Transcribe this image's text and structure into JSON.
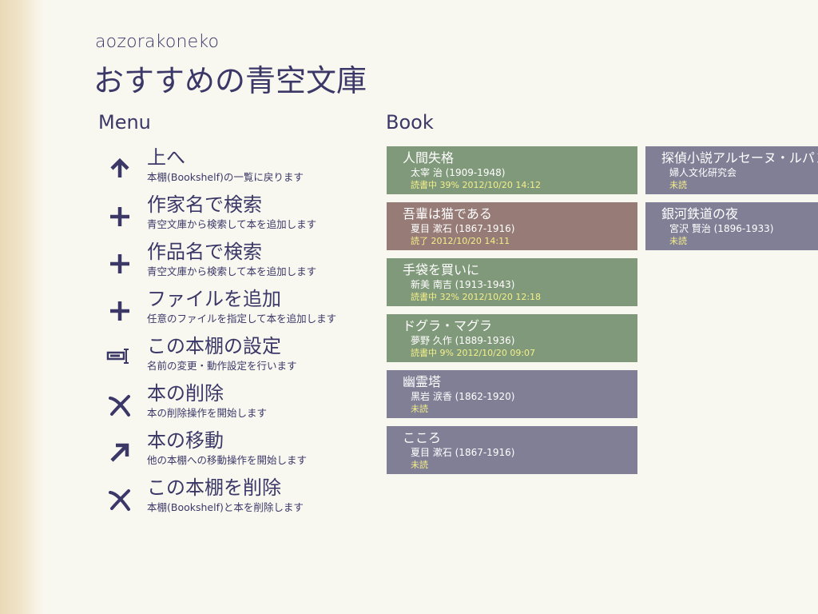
{
  "app": {
    "name": "aozorakoneko",
    "title": "おすすめの青空文庫"
  },
  "menu": {
    "heading": "Menu",
    "items": [
      {
        "icon": "arrow-up-icon",
        "label": "上へ",
        "description": "本棚(Bookshelf)の一覧に戻ります"
      },
      {
        "icon": "plus-icon",
        "label": "作家名で検索",
        "description": "青空文庫から検索して本を追加します"
      },
      {
        "icon": "plus-icon",
        "label": "作品名で検索",
        "description": "青空文庫から検索して本を追加します"
      },
      {
        "icon": "plus-icon",
        "label": "ファイルを追加",
        "description": "任意のファイルを指定して本を追加します"
      },
      {
        "icon": "rename-icon",
        "label": "この本棚の設定",
        "description": "名前の変更・動作設定を行います"
      },
      {
        "icon": "delete-icon",
        "label": "本の削除",
        "description": "本の削除操作を開始します"
      },
      {
        "icon": "move-arrow-icon",
        "label": "本の移動",
        "description": "他の本棚への移動操作を開始します"
      },
      {
        "icon": "delete-icon",
        "label": "この本棚を削除",
        "description": "本棚(Bookshelf)と本を削除します"
      }
    ]
  },
  "books": {
    "heading": "Book",
    "items": [
      {
        "title": "人間失格",
        "author": "太宰 治 (1909-1948)",
        "status": "読書中 39% 2012/10/20 14:12",
        "color": "#80997a"
      },
      {
        "title": "吾輩は猫である",
        "author": "夏目 漱石 (1867-1916)",
        "status": "読了 2012/10/20 14:11",
        "color": "#967b76"
      },
      {
        "title": "手袋を買いに",
        "author": "新美 南吉 (1913-1943)",
        "status": "読書中 32% 2012/10/20 12:18",
        "color": "#80997a"
      },
      {
        "title": "ドグラ・マグラ",
        "author": "夢野 久作 (1889-1936)",
        "status": "読書中 9% 2012/10/20 09:07",
        "color": "#80997a"
      },
      {
        "title": "幽霊塔",
        "author": "黒岩 涙香 (1862-1920)",
        "status": "未読",
        "color": "#807f96"
      },
      {
        "title": "こころ",
        "author": "夏目 漱石 (1867-1916)",
        "status": "未読",
        "color": "#807f96"
      },
      {
        "title": "探偵小説アルセーヌ・ルパン",
        "author": "婦人文化研究会",
        "status": "未読",
        "color": "#807f96"
      },
      {
        "title": "銀河鉄道の夜",
        "author": "宮沢 賢治 (1896-1933)",
        "status": "未読",
        "color": "#807f96"
      }
    ]
  }
}
